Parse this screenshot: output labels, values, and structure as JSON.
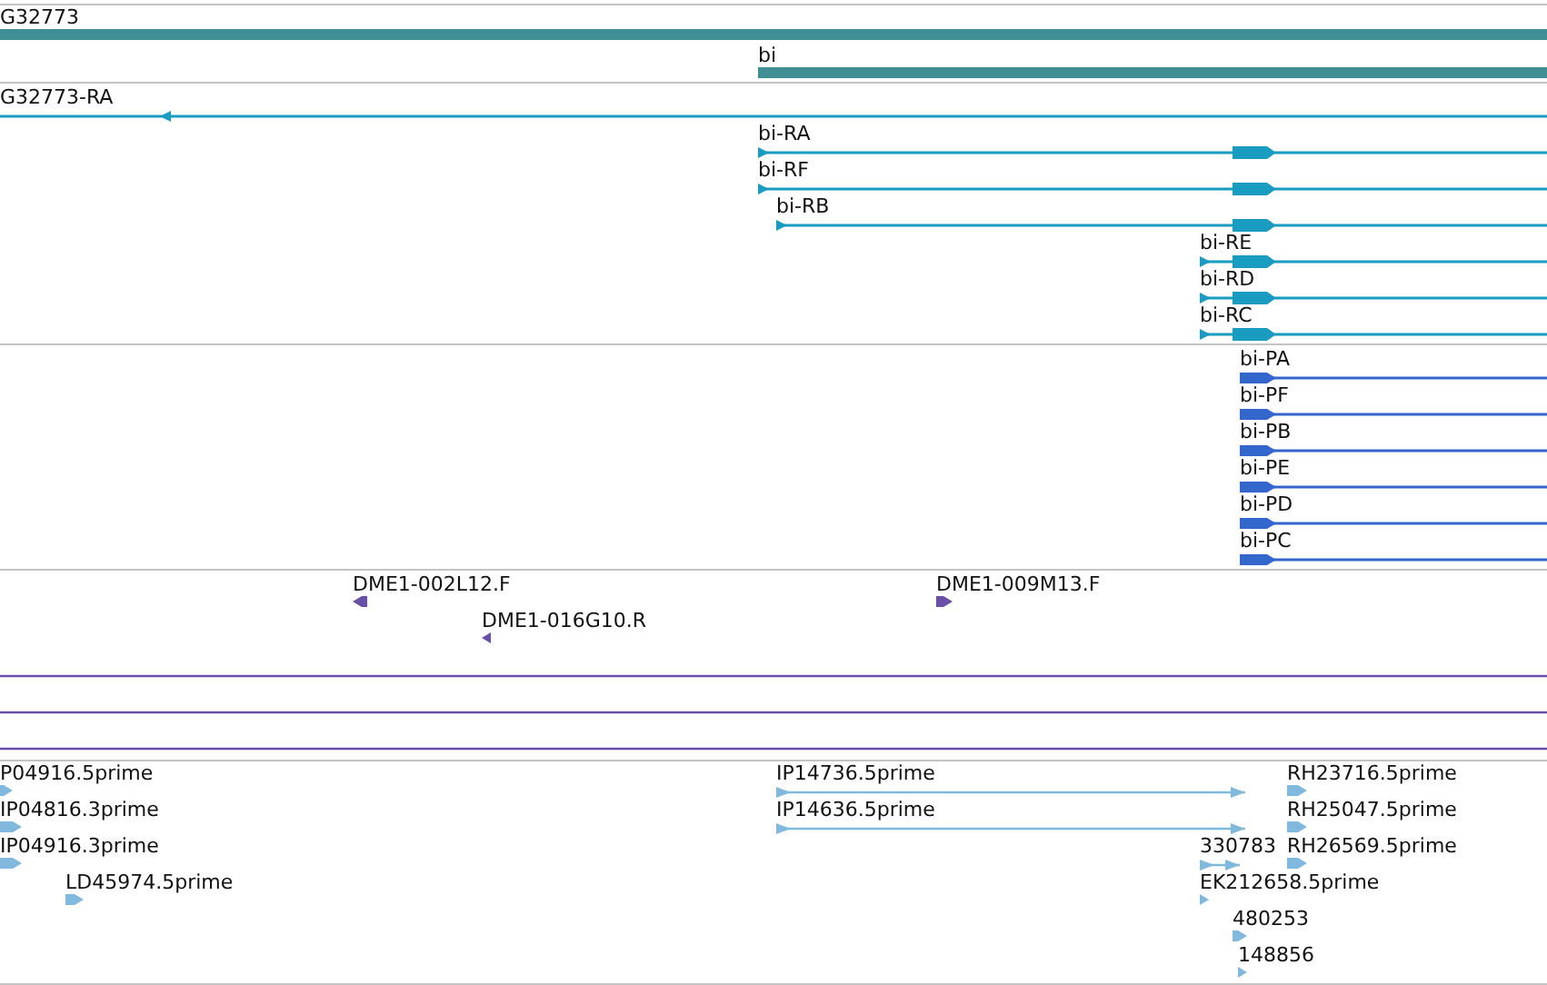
{
  "tracks": [
    {
      "kind": "gene",
      "features": [
        {
          "label": "G32773"
        },
        {
          "label": "bi"
        }
      ]
    },
    {
      "kind": "transcript",
      "features": [
        {
          "label": "G32773-RA",
          "reverse": true
        },
        {
          "label": "bi-RA",
          "reverse": false
        },
        {
          "label": "bi-RF",
          "reverse": false
        },
        {
          "label": "bi-RB",
          "reverse": false
        },
        {
          "label": "bi-RE",
          "reverse": false
        },
        {
          "label": "bi-RD",
          "reverse": false
        },
        {
          "label": "bi-RC",
          "reverse": false
        }
      ]
    },
    {
      "kind": "protein",
      "features": [
        {
          "label": "bi-PA",
          "reverse": false
        },
        {
          "label": "bi-PF",
          "reverse": false
        },
        {
          "label": "bi-PB",
          "reverse": false
        },
        {
          "label": "bi-PE",
          "reverse": false
        },
        {
          "label": "bi-PD",
          "reverse": false
        },
        {
          "label": "bi-PC",
          "reverse": false
        }
      ]
    },
    {
      "kind": "clone",
      "features": [
        {
          "kind": "end",
          "label": "DME1-002L12.F",
          "reverse": true
        },
        {
          "kind": "end",
          "label": "DME1-009M13.F",
          "reverse": false
        },
        {
          "kind": "end",
          "label": "DME1-016G10.R",
          "reverse": true
        },
        {
          "kind": "span"
        },
        {
          "kind": "span"
        },
        {
          "kind": "span"
        }
      ]
    },
    {
      "kind": "est",
      "features": [
        {
          "kind": "end",
          "label": "P04916.5prime",
          "reverse": false
        },
        {
          "kind": "span",
          "label": "IP14736.5prime",
          "reverse": false
        },
        {
          "kind": "end",
          "label": "RH23716.5prime",
          "reverse": false
        },
        {
          "kind": "end",
          "label": "IP04816.3prime",
          "reverse": false
        },
        {
          "kind": "span",
          "label": "IP14636.5prime",
          "reverse": false
        },
        {
          "kind": "end",
          "label": "RH25047.5prime",
          "reverse": false
        },
        {
          "kind": "end",
          "label": "IP04916.3prime",
          "reverse": false
        },
        {
          "kind": "span",
          "label": "330783",
          "reverse": false
        },
        {
          "kind": "end",
          "label": "RH26569.5prime",
          "reverse": false
        },
        {
          "kind": "end",
          "label": "LD45974.5prime",
          "reverse": false
        },
        {
          "kind": "end",
          "label": "EK212658.5prime",
          "reverse": false
        },
        {
          "kind": "end",
          "label": "480253",
          "reverse": false
        },
        {
          "kind": "end",
          "label": "148856",
          "reverse": false
        }
      ]
    }
  ]
}
